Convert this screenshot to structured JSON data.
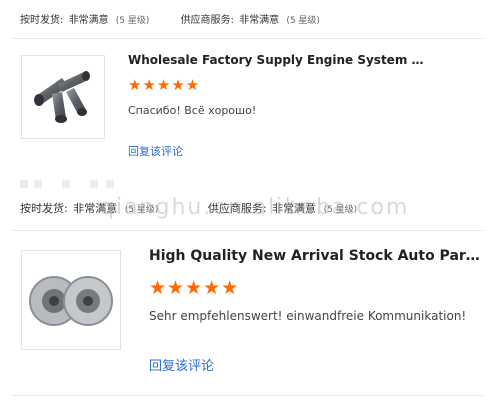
{
  "top_rating": {
    "delivery_label": "按时发货:",
    "delivery_value": "非常满意",
    "delivery_level": "(5 星级)",
    "service_label": "供应商服务:",
    "service_value": "非常满意",
    "service_level": "(5 星级)"
  },
  "reviews": [
    {
      "product_title": "Wholesale Factory Supply Engine System Parts...",
      "stars": "★★★★★",
      "rating": 5,
      "comment": "Спасибо! Всё хорошо!",
      "reply_label": "回复该评论"
    },
    {
      "product_title": "High Quality New Arrival Stock Auto Parts Man...",
      "stars": "★★★★★",
      "rating": 5,
      "comment": "Sehr empfehlenswert! einwandfreie Kommunikation!",
      "reply_label": "回复该评论"
    }
  ],
  "middle_rating": {
    "delivery_label": "按时发货:",
    "delivery_value": "非常满意",
    "delivery_level": "(5 星级)",
    "service_label": "供应商服务:",
    "service_value": "非常满意",
    "service_level": "(5 星级)"
  },
  "watermark": "qianghu.en.alibaba.com",
  "colors": {
    "accent_star": "#ff6a00",
    "link": "#2b6bd8"
  }
}
